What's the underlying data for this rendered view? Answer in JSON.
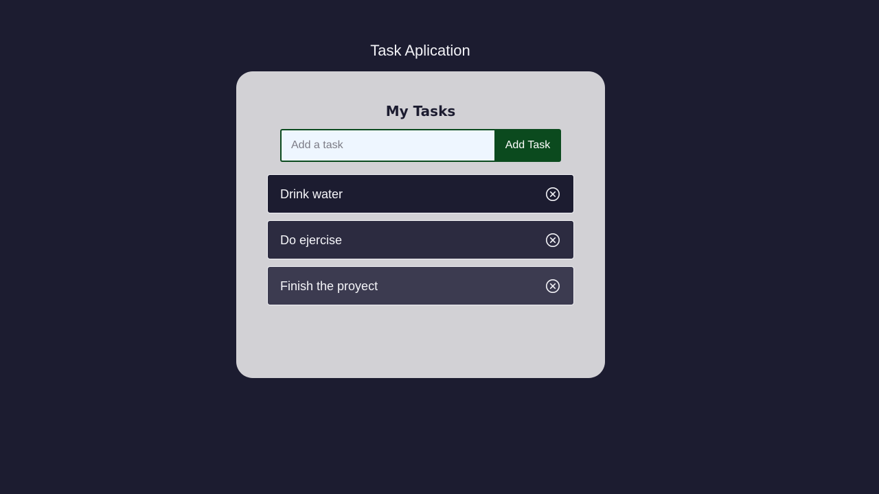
{
  "app": {
    "title": "Task Aplication"
  },
  "card": {
    "title": "My Tasks",
    "input_placeholder": "Add a task",
    "input_value": "",
    "add_button_label": "Add Task"
  },
  "tasks": [
    {
      "text": "Drink water",
      "bg": "#1c1c30",
      "delete_icon": "circle-x-icon"
    },
    {
      "text": "Do ejercise",
      "bg": "#2c2b40",
      "delete_icon": "circle-x-icon"
    },
    {
      "text": "Finish the proyect",
      "bg": "#3c3b50",
      "delete_icon": "circle-x-icon"
    }
  ],
  "colors": {
    "page_bg": "#1c1c30",
    "card_bg": "#d2d1d5",
    "accent_green": "#0b4a1e",
    "input_bg": "#eef6ff"
  }
}
